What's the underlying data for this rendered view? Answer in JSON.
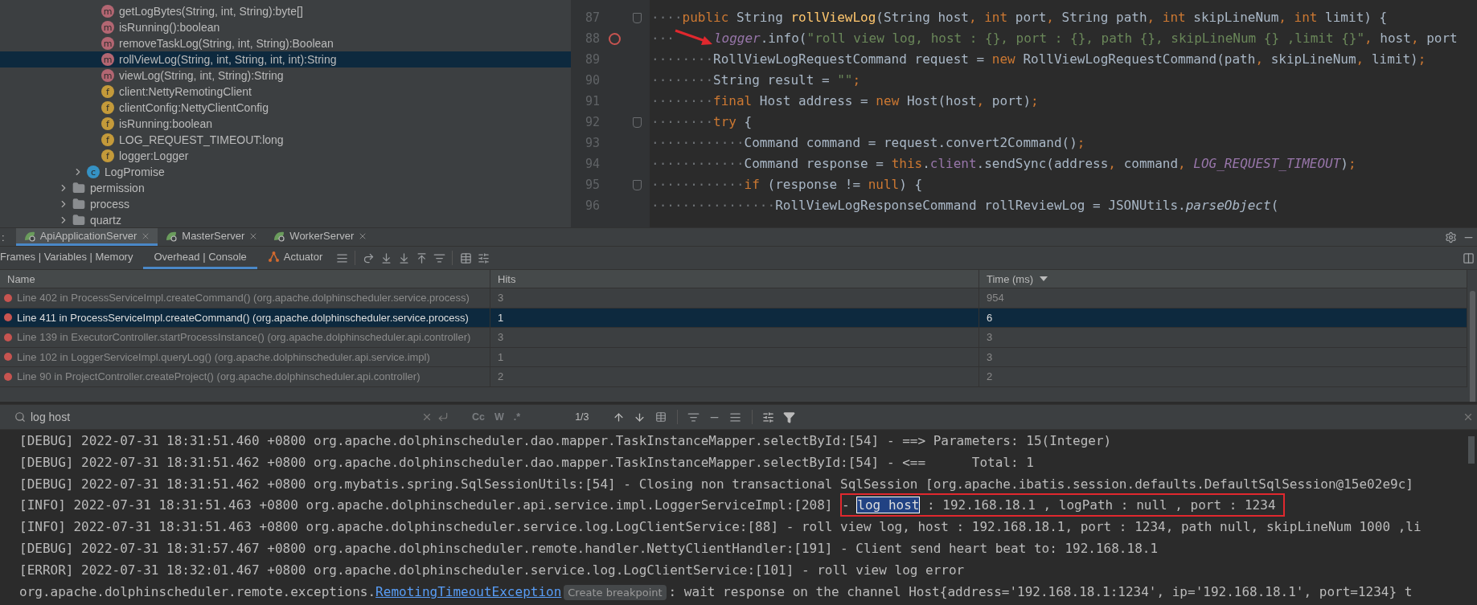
{
  "project_tree": {
    "items": [
      {
        "children": [
          {
            "children": [
              {
                "label": "getLogBytes(String, int, String):byte[]",
                "kind": "method",
                "icon_letter": "m",
                "selected": false
              },
              {
                "label": "isRunning():boolean",
                "kind": "method",
                "icon_letter": "m",
                "selected": false
              },
              {
                "label": "removeTaskLog(String, int, String):Boolean",
                "kind": "method",
                "icon_letter": "m",
                "selected": false
              },
              {
                "label": "rollViewLog(String, int, String, int, int):String",
                "kind": "method",
                "icon_letter": "m",
                "selected": true
              },
              {
                "label": "viewLog(String, int, String):String",
                "kind": "method",
                "icon_letter": "m",
                "selected": false
              },
              {
                "label": "client:NettyRemotingClient",
                "kind": "field",
                "icon_letter": "f",
                "selected": false
              },
              {
                "label": "clientConfig:NettyClientConfig",
                "kind": "field",
                "icon_letter": "f",
                "selected": false
              },
              {
                "label": "isRunning:boolean",
                "kind": "field",
                "icon_letter": "f",
                "selected": false
              },
              {
                "label": "LOG_REQUEST_TIMEOUT:long",
                "kind": "field",
                "icon_letter": "f",
                "selected": false
              },
              {
                "label": "logger:Logger",
                "kind": "field",
                "icon_letter": "f",
                "selected": false
              }
            ]
          },
          {
            "label": "LogPromise",
            "kind": "class",
            "icon_letter": "c",
            "selected": false,
            "expanded": false
          }
        ]
      },
      {
        "label": "permission",
        "kind": "folder",
        "selected": false,
        "expanded": false
      },
      {
        "label": "process",
        "kind": "folder",
        "selected": false,
        "expanded": false
      },
      {
        "label": "quartz",
        "kind": "folder",
        "selected": false,
        "expanded": false
      }
    ]
  },
  "editor": {
    "lines": [
      {
        "number": "87",
        "breakpoint": false,
        "fold": true,
        "tokens": [
          {
            "kind": "ws",
            "text": "····"
          },
          {
            "kind": "kw",
            "text": "public"
          },
          {
            "kind": "plain",
            "text": " String "
          },
          {
            "kind": "fn",
            "text": "rollViewLog"
          },
          {
            "kind": "plain",
            "text": "(String host"
          },
          {
            "kind": "kw",
            "text": ","
          },
          {
            "kind": "kw",
            "text": " int"
          },
          {
            "kind": "plain",
            "text": " port"
          },
          {
            "kind": "kw",
            "text": ","
          },
          {
            "kind": "plain",
            "text": " String path"
          },
          {
            "kind": "kw",
            "text": ","
          },
          {
            "kind": "kw",
            "text": " int"
          },
          {
            "kind": "plain",
            "text": " skipLineNum"
          },
          {
            "kind": "kw",
            "text": ","
          },
          {
            "kind": "kw",
            "text": " int"
          },
          {
            "kind": "plain",
            "text": " limit) {"
          }
        ]
      },
      {
        "number": "88",
        "breakpoint": true,
        "fold": false,
        "tokens": [
          {
            "kind": "ws",
            "text": "···"
          },
          {
            "kind": "arrow"
          },
          {
            "kind": "static",
            "text": "logger"
          },
          {
            "kind": "plain",
            "text": ".info("
          },
          {
            "kind": "str",
            "text": "\"roll view log, host : {}, port : {}, path {}, skipLineNum {} ,limit {}\""
          },
          {
            "kind": "kw",
            "text": ","
          },
          {
            "kind": "plain",
            "text": " host"
          },
          {
            "kind": "kw",
            "text": ","
          },
          {
            "kind": "plain",
            "text": " port"
          }
        ]
      },
      {
        "number": "89",
        "breakpoint": false,
        "fold": false,
        "tokens": [
          {
            "kind": "ws",
            "text": "········"
          },
          {
            "kind": "plain",
            "text": "RollViewLogRequestCommand request = "
          },
          {
            "kind": "kw",
            "text": "new"
          },
          {
            "kind": "plain",
            "text": " RollViewLogRequestCommand(path"
          },
          {
            "kind": "kw",
            "text": ","
          },
          {
            "kind": "plain",
            "text": " skipLineNum"
          },
          {
            "kind": "kw",
            "text": ","
          },
          {
            "kind": "plain",
            "text": " limit)"
          },
          {
            "kind": "kw",
            "text": ";"
          }
        ]
      },
      {
        "number": "90",
        "breakpoint": false,
        "fold": false,
        "tokens": [
          {
            "kind": "ws",
            "text": "········"
          },
          {
            "kind": "plain",
            "text": "String result = "
          },
          {
            "kind": "str",
            "text": "\"\""
          },
          {
            "kind": "kw",
            "text": ";"
          }
        ]
      },
      {
        "number": "91",
        "breakpoint": false,
        "fold": false,
        "tokens": [
          {
            "kind": "ws",
            "text": "········"
          },
          {
            "kind": "kw",
            "text": "final"
          },
          {
            "kind": "plain",
            "text": " Host address = "
          },
          {
            "kind": "kw",
            "text": "new"
          },
          {
            "kind": "plain",
            "text": " Host(host"
          },
          {
            "kind": "kw",
            "text": ","
          },
          {
            "kind": "plain",
            "text": " port)"
          },
          {
            "kind": "kw",
            "text": ";"
          }
        ]
      },
      {
        "number": "92",
        "breakpoint": false,
        "fold": true,
        "tokens": [
          {
            "kind": "ws",
            "text": "········"
          },
          {
            "kind": "kw",
            "text": "try"
          },
          {
            "kind": "plain",
            "text": " {"
          }
        ]
      },
      {
        "number": "93",
        "breakpoint": false,
        "fold": false,
        "tokens": [
          {
            "kind": "ws",
            "text": "············"
          },
          {
            "kind": "plain",
            "text": "Command command = request.convert2Command()"
          },
          {
            "kind": "kw",
            "text": ";"
          }
        ]
      },
      {
        "number": "94",
        "breakpoint": false,
        "fold": false,
        "tokens": [
          {
            "kind": "ws",
            "text": "············"
          },
          {
            "kind": "plain",
            "text": "Command response = "
          },
          {
            "kind": "kw",
            "text": "this"
          },
          {
            "kind": "plain",
            "text": "."
          },
          {
            "kind": "member",
            "text": "client"
          },
          {
            "kind": "plain",
            "text": ".sendSync(address"
          },
          {
            "kind": "kw",
            "text": ","
          },
          {
            "kind": "plain",
            "text": " command"
          },
          {
            "kind": "kw",
            "text": ", "
          },
          {
            "kind": "static",
            "text": "LOG_REQUEST_TIMEOUT"
          },
          {
            "kind": "plain",
            "text": ")"
          },
          {
            "kind": "kw",
            "text": ";"
          }
        ]
      },
      {
        "number": "95",
        "breakpoint": false,
        "fold": true,
        "tokens": [
          {
            "kind": "ws",
            "text": "············"
          },
          {
            "kind": "kw",
            "text": "if"
          },
          {
            "kind": "plain",
            "text": " (response != "
          },
          {
            "kind": "kw",
            "text": "null"
          },
          {
            "kind": "plain",
            "text": ") {"
          }
        ]
      },
      {
        "number": "96",
        "breakpoint": false,
        "fold": false,
        "tokens": [
          {
            "kind": "ws",
            "text": "················"
          },
          {
            "kind": "plain",
            "text": "RollViewLogResponseCommand rollReviewLog = JSONUtils."
          },
          {
            "kind": "italic",
            "text": "parseObject"
          },
          {
            "kind": "plain",
            "text": "("
          }
        ]
      }
    ]
  },
  "run_tabs": {
    "prefix": ":",
    "tabs": [
      {
        "label": "ApiApplicationServer",
        "selected": true
      },
      {
        "label": "MasterServer",
        "selected": false
      },
      {
        "label": "WorkerServer",
        "selected": false
      }
    ]
  },
  "debug_tabs": [
    {
      "label": "Frames | Variables | Memory",
      "selected": false,
      "kind": "text"
    },
    {
      "label": "Overhead | Console",
      "selected": true,
      "kind": "text"
    },
    {
      "label": "Actuator",
      "selected": false,
      "kind": "actuator"
    }
  ],
  "overhead_table": {
    "columns": [
      {
        "label": "Name",
        "sorted": false
      },
      {
        "label": "Hits",
        "sorted": false
      },
      {
        "label": "Time (ms)",
        "sorted": true
      }
    ],
    "rows": [
      {
        "name": "Line 402 in ProcessServiceImpl.createCommand() (org.apache.dolphinscheduler.service.process)",
        "hits": "3",
        "time": "954",
        "selected": false
      },
      {
        "name": "Line 411 in ProcessServiceImpl.createCommand() (org.apache.dolphinscheduler.service.process)",
        "hits": "1",
        "time": "6",
        "selected": true
      },
      {
        "name": "Line 139 in ExecutorController.startProcessInstance() (org.apache.dolphinscheduler.api.controller)",
        "hits": "3",
        "time": "3",
        "selected": false
      },
      {
        "name": "Line 102 in LoggerServiceImpl.queryLog() (org.apache.dolphinscheduler.api.service.impl)",
        "hits": "1",
        "time": "3",
        "selected": false
      },
      {
        "name": "Line 90 in ProjectController.createProject() (org.apache.dolphinscheduler.api.controller)",
        "hits": "2",
        "time": "2",
        "selected": false
      }
    ]
  },
  "console_search": {
    "value": "log host",
    "options": [
      "Cc",
      "W",
      ".*"
    ],
    "match_count": "1/3"
  },
  "console": {
    "lines": [
      {
        "segments": [
          {
            "kind": "plain",
            "text": "[DEBUG] 2022-07-31 18:31:51.460 +0800 org.apache.dolphinscheduler.dao.mapper.TaskInstanceMapper.selectById:[54] - ==> Parameters: 15(Integer)"
          }
        ]
      },
      {
        "segments": [
          {
            "kind": "plain",
            "text": "[DEBUG] 2022-07-31 18:31:51.462 +0800 org.apache.dolphinscheduler.dao.mapper.TaskInstanceMapper.selectById:[54] - <==      Total: 1"
          }
        ]
      },
      {
        "segments": [
          {
            "kind": "plain",
            "text": "[DEBUG] 2022-07-31 18:31:51.462 +0800 org.mybatis.spring.SqlSessionUtils:[54] - Closing non transactional SqlSession [org.apache.ibatis.session.defaults.DefaultSqlSession@15e02e9c]"
          }
        ]
      },
      {
        "segments": [
          {
            "kind": "plain",
            "text": "[INFO] 2022-07-31 18:31:51.463 +0800 org.apache.dolphinscheduler.api.service.impl.LoggerServiceImpl:[208] "
          },
          {
            "kind": "plain",
            "text": "- ",
            "framed": true
          },
          {
            "kind": "match",
            "text": "log host",
            "framed": true
          },
          {
            "kind": "plain",
            "text": " : 192.168.18.1 , logPath : null , port : 1234 ",
            "framed": true
          }
        ]
      },
      {
        "segments": [
          {
            "kind": "plain",
            "text": "[INFO] 2022-07-31 18:31:51.463 +0800 org.apache.dolphinscheduler.service.log.LogClientService:[88] - roll view log, host : 192.168.18.1, port : 1234, path null, skipLineNum 1000 ,li"
          }
        ]
      },
      {
        "segments": [
          {
            "kind": "plain",
            "text": "[DEBUG] 2022-07-31 18:31:57.467 +0800 org.apache.dolphinscheduler.remote.handler.NettyClientHandler:[191] - Client send heart beat to: 192.168.18.1"
          }
        ]
      },
      {
        "segments": [
          {
            "kind": "plain",
            "text": "[ERROR] 2022-07-31 18:32:01.467 +0800 org.apache.dolphinscheduler.service.log.LogClientService:[101] - roll view log error"
          }
        ]
      },
      {
        "segments": [
          {
            "kind": "plain",
            "text": "org.apache.dolphinscheduler.remote.exceptions."
          },
          {
            "kind": "link",
            "text": "RemotingTimeoutException"
          },
          {
            "kind": "chip",
            "text": "Create breakpoint"
          },
          {
            "kind": "plain",
            "text": ": wait response on the channel Host{address='192.168.18.1:1234', ip='192.168.18.1', port=1234} t"
          }
        ]
      }
    ]
  }
}
